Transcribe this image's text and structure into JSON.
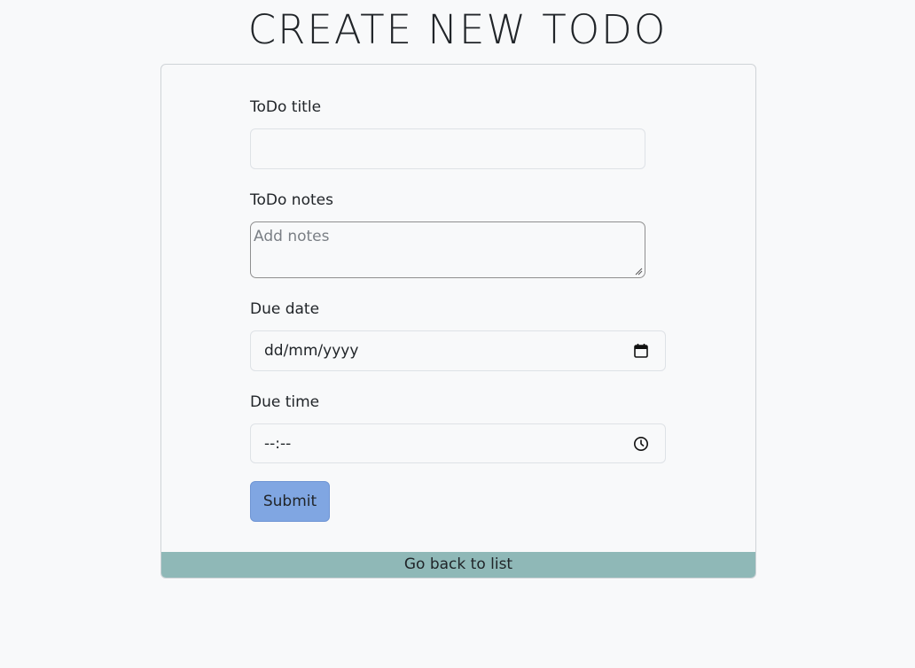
{
  "page": {
    "title": "CREATE NEW TODO"
  },
  "form": {
    "title_label": "ToDo title",
    "title_value": "",
    "notes_label": "ToDo notes",
    "notes_placeholder": "Add notes",
    "due_date_label": "Due date",
    "due_date_value": "dd/mm/yyyy",
    "due_time_label": "Due time",
    "due_time_value": "--:--",
    "submit_label": "Submit"
  },
  "footer": {
    "back_link_label": "Go back to list"
  },
  "icons": {
    "date": "calendar-icon",
    "time": "clock-icon",
    "resize": "resize-grip-icon"
  },
  "colors": {
    "background": "#f8f9fa",
    "submit_button": "#80a6e2",
    "back_bar": "#8fb8b7"
  }
}
